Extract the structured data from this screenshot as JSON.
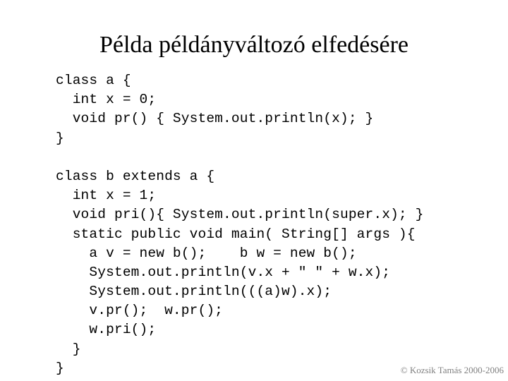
{
  "slide": {
    "title": "Példa példányváltozó elfedésére",
    "background_color": "#ffffff",
    "text_color": "#000000",
    "footer_color": "#808080"
  },
  "code": {
    "language": "java",
    "lines": [
      "class a {",
      "  int x = 0;",
      "  void pr() { System.out.println(x); }",
      "}",
      "",
      "class b extends a {",
      "  int x = 1;",
      "  void pri(){ System.out.println(super.x); }",
      "  static public void main( String[] args ){",
      "    a v = new b();    b w = new b();",
      "    System.out.println(v.x + \" \" + w.x);",
      "    System.out.println(((a)w).x);",
      "    v.pr();  w.pr();",
      "    w.pri();",
      "  }",
      "}"
    ]
  },
  "footer": {
    "copyright": "© Kozsik Tamás 2000-2006"
  }
}
